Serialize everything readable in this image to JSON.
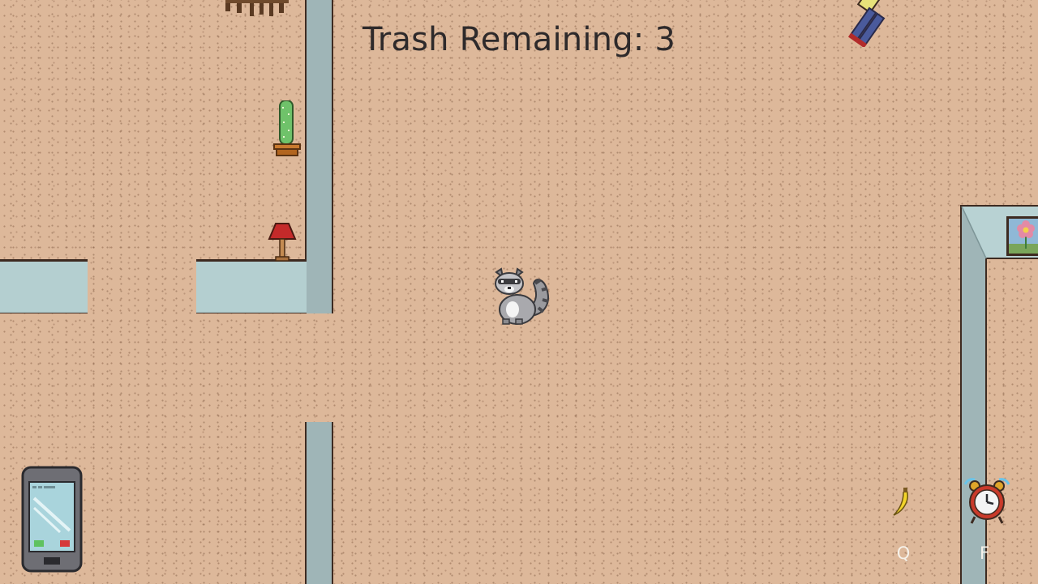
{
  "hud": {
    "trash_label": "Trash Remaining: 3"
  },
  "controls": {
    "item_key": "Q",
    "alarm_key": "F"
  },
  "icons": {
    "phone": "phone-icon",
    "banana": "banana-icon",
    "alarm_clock": "alarm-clock-icon",
    "player": "raccoon-icon",
    "cactus": "cactus-icon",
    "lamp": "lamp-icon",
    "painting": "flower-painting-icon",
    "npc": "sleeping-human-icon"
  },
  "colors": {
    "floor": "#ddb89a",
    "wall_fill": "#9fb5b7",
    "wall_top": "#b4cfd0",
    "wall_edge": "#3d2a20",
    "hud_text": "#2e2a2b"
  }
}
